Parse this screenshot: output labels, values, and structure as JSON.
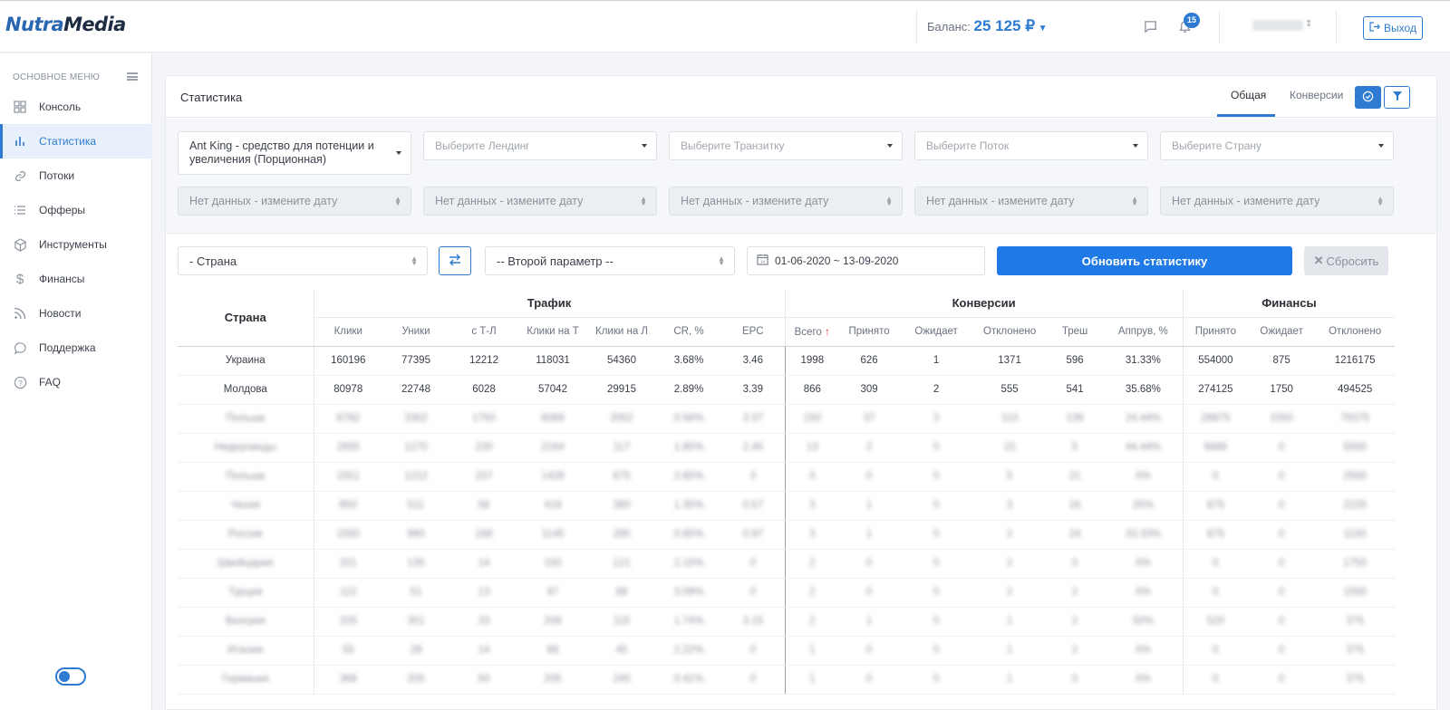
{
  "header": {
    "logo_part1": "Nutra",
    "logo_part2": "Media",
    "balance_label": "Баланс:",
    "balance_amount": "25 125 ₽",
    "notification_count": "15",
    "logout_label": "Выход"
  },
  "sidebar": {
    "menu_title": "ОСНОВНОЕ МЕНЮ",
    "items": [
      {
        "label": "Консоль",
        "icon": "dashboard-icon"
      },
      {
        "label": "Статистика",
        "icon": "bar-chart-icon"
      },
      {
        "label": "Потоки",
        "icon": "link-icon"
      },
      {
        "label": "Офферы",
        "icon": "list-icon"
      },
      {
        "label": "Инструменты",
        "icon": "box-icon"
      },
      {
        "label": "Финансы",
        "icon": "dollar-icon"
      },
      {
        "label": "Новости",
        "icon": "rss-icon"
      },
      {
        "label": "Поддержка",
        "icon": "chat-icon"
      },
      {
        "label": "FAQ",
        "icon": "question-icon"
      }
    ]
  },
  "page": {
    "title": "Статистика",
    "tabs": [
      "Общая",
      "Конверсии"
    ]
  },
  "filters": {
    "offer_value": "Ant King - средство для потенции и увеличения (Порционная)",
    "landing_placeholder": "Выберите Лендинг",
    "transit_placeholder": "Выберите Транзитку",
    "stream_placeholder": "Выберите Поток",
    "country_placeholder": "Выберите Страну",
    "no_data": "Нет данных - измените дату"
  },
  "controls": {
    "param1": "- Страна",
    "param2": "-- Второй параметр --",
    "date_range": "01-06-2020 ~ 13-09-2020",
    "refresh_label": "Обновить статистику",
    "reset_label": "Сбросить"
  },
  "table": {
    "groups": {
      "country": "Страна",
      "traffic": "Трафик",
      "conversions": "Конверсии",
      "finance": "Финансы"
    },
    "columns": [
      "Клики",
      "Уники",
      "с Т-Л",
      "Клики на Т",
      "Клики на Л",
      "CR, %",
      "EPC",
      "Всего",
      "Принято",
      "Ожидает",
      "Отклонено",
      "Треш",
      "Аппрув, %",
      "Принято",
      "Ожидает",
      "Отклонено"
    ],
    "rows": [
      [
        "Украина",
        "160196",
        "77395",
        "12212",
        "118031",
        "54360",
        "3.68%",
        "3.46",
        "1998",
        "626",
        "1",
        "1371",
        "596",
        "31.33%",
        "554000",
        "875",
        "1216175"
      ],
      [
        "Молдова",
        "80978",
        "22748",
        "6028",
        "57042",
        "29915",
        "2.89%",
        "3.39",
        "866",
        "309",
        "2",
        "555",
        "541",
        "35.68%",
        "274125",
        "1750",
        "494525"
      ],
      [
        "Польша",
        "8782",
        "3302",
        "1750",
        "6069",
        "2002",
        "0.56%",
        "3.37",
        "150",
        "37",
        "3",
        "110",
        "139",
        "24.44%",
        "28875",
        "1550",
        "79375"
      ],
      [
        "Нидерланды",
        "2655",
        "1270",
        "230",
        "2164",
        "117",
        "1.85%",
        "2.45",
        "13",
        "2",
        "0",
        "15",
        "5",
        "44.44%",
        "6666",
        "0",
        "5550"
      ],
      [
        "Польша",
        "1551",
        "1212",
        "157",
        "1428",
        "675",
        "2.65%",
        "3",
        "0",
        "0",
        "0",
        "5",
        "21",
        "0%",
        "0",
        "0",
        "2550"
      ],
      [
        "Чехия",
        "850",
        "511",
        "56",
        "416",
        "380",
        "1.35%",
        "0.57",
        "3",
        "1",
        "0",
        "3",
        "16",
        "25%",
        "875",
        "0",
        "2225"
      ],
      [
        "Россия",
        "1550",
        "990",
        "168",
        "1145",
        "285",
        "0.65%",
        "0.97",
        "3",
        "1",
        "0",
        "2",
        "24",
        "33.33%",
        "875",
        "0",
        "1150"
      ],
      [
        "Швейцария",
        "201",
        "135",
        "14",
        "150",
        "121",
        "2.15%",
        "0",
        "2",
        "0",
        "0",
        "2",
        "0",
        "0%",
        "0",
        "0",
        "1750"
      ],
      [
        "Турция",
        "110",
        "51",
        "13",
        "97",
        "88",
        "3.09%",
        "0",
        "2",
        "0",
        "0",
        "2",
        "2",
        "0%",
        "0",
        "0",
        "1550"
      ],
      [
        "Венгрия",
        "205",
        "301",
        "33",
        "208",
        "115",
        "1.74%",
        "3.15",
        "2",
        "1",
        "0",
        "1",
        "2",
        "50%",
        "520",
        "0",
        "375"
      ],
      [
        "Италия",
        "55",
        "28",
        "14",
        "68",
        "45",
        "2.22%",
        "0",
        "1",
        "0",
        "0",
        "1",
        "2",
        "0%",
        "0",
        "0",
        "375"
      ],
      [
        "Германия",
        "368",
        "205",
        "50",
        "205",
        "245",
        "0.41%",
        "0",
        "1",
        "0",
        "0",
        "1",
        "0",
        "0%",
        "0",
        "0",
        "375"
      ]
    ]
  },
  "colors": {
    "accent": "#2e7bd1",
    "primary_button": "#1f7ae8",
    "sort_arrow": "#d03b3b"
  }
}
